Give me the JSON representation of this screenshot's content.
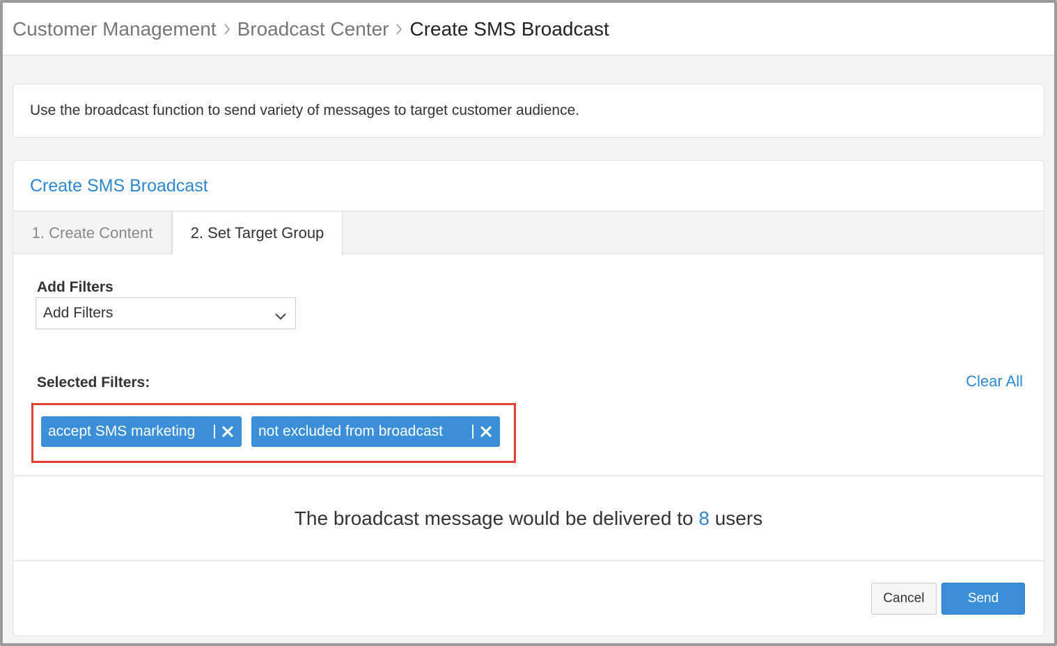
{
  "breadcrumb": {
    "items": [
      "Customer Management",
      "Broadcast Center"
    ],
    "current": "Create SMS Broadcast"
  },
  "info": {
    "text": "Use the broadcast function to send variety of messages to target customer audience."
  },
  "card": {
    "title": "Create SMS Broadcast"
  },
  "tabs": [
    {
      "label": "1. Create Content",
      "active": false
    },
    {
      "label": "2. Set Target Group",
      "active": true
    }
  ],
  "filters": {
    "add_label": "Add Filters",
    "select_value": "Add Filters",
    "selected_label": "Selected Filters:",
    "clear_all": "Clear All",
    "chips": [
      "accept SMS marketing",
      "not excluded from broadcast"
    ]
  },
  "delivery": {
    "prefix": "The broadcast message would be delivered to",
    "count": "8",
    "suffix": "users"
  },
  "actions": {
    "cancel": "Cancel",
    "send": "Send"
  },
  "colors": {
    "accent": "#2d87d3",
    "chip": "#3b8fd8",
    "highlight": "#e1412f"
  },
  "icons": {
    "breadcrumb_separator": "chevron-right-icon",
    "select_toggle": "chevron-down-icon",
    "chip_remove": "close-icon"
  }
}
